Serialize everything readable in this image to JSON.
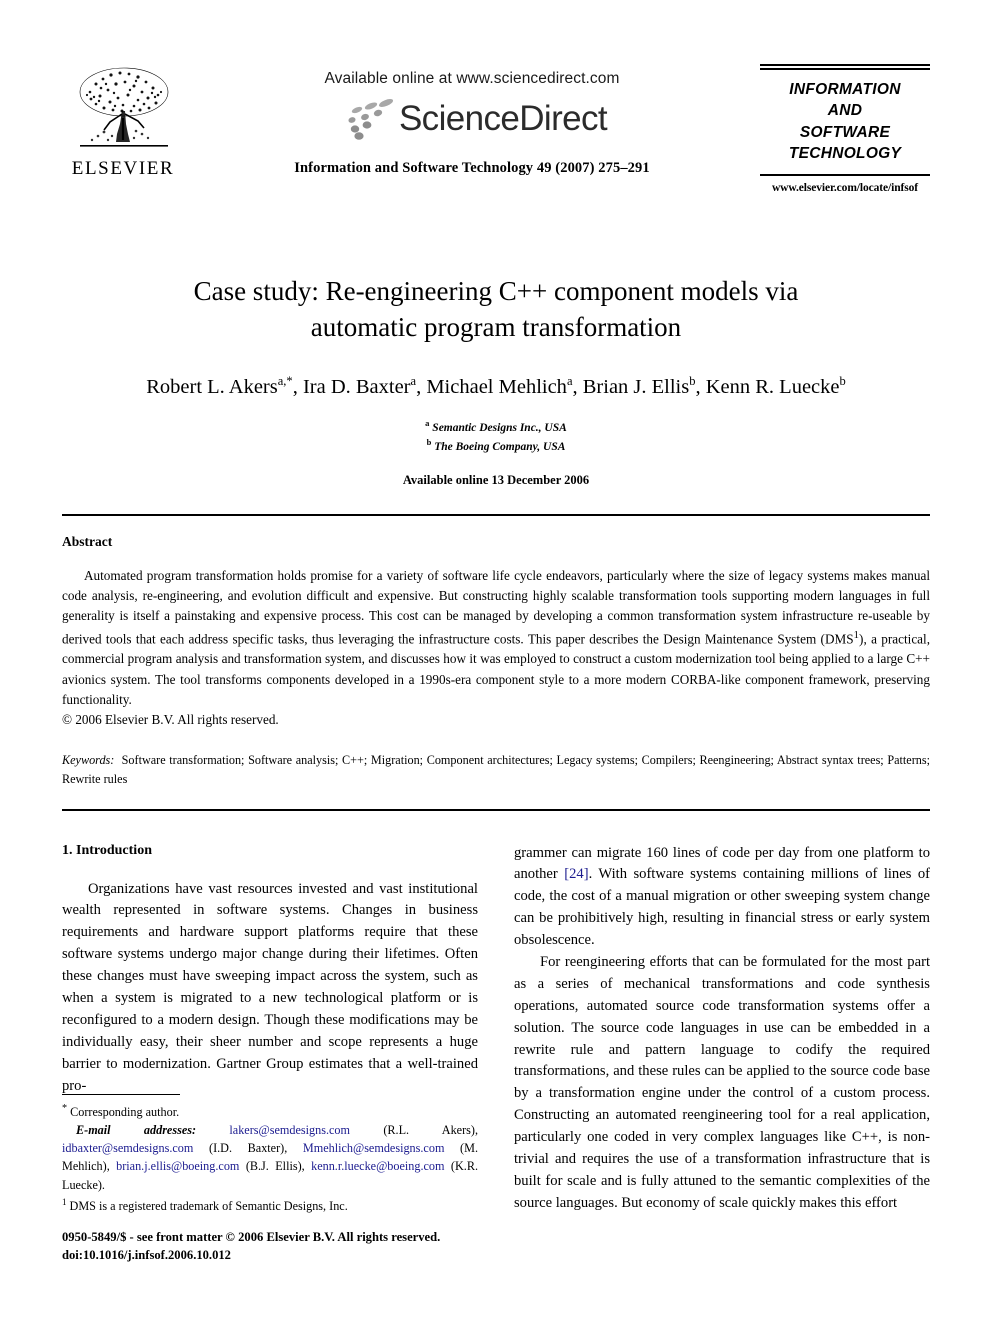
{
  "masthead": {
    "publisher_name": "ELSEVIER",
    "publisher_logo_icon": "elsevier-tree-icon",
    "available_online": "Available online at www.sciencedirect.com",
    "sciencedirect_wordmark": "ScienceDirect",
    "sciencedirect_logo_icon": "sciencedirect-swoosh-icon",
    "journal_reference": "Information and Software Technology 49 (2007) 275–291",
    "journal_title_lines": [
      "INFORMATION",
      "AND",
      "SOFTWARE",
      "TECHNOLOGY"
    ],
    "journal_url": "www.elsevier.com/locate/infsof"
  },
  "title_block": {
    "title_line_1": "Case study: Re-engineering C++ component models via",
    "title_line_2": "automatic program transformation",
    "authors": [
      {
        "name": "Robert L. Akers",
        "marks": "a,*",
        "sep": ", "
      },
      {
        "name": "Ira D. Baxter",
        "marks": "a",
        "sep": ", "
      },
      {
        "name": "Michael Mehlich",
        "marks": "a",
        "sep": ", "
      },
      {
        "name": "Brian J. Ellis",
        "marks": "b",
        "sep": ", "
      },
      {
        "name": "Kenn R. Luecke",
        "marks": "b",
        "sep": ""
      }
    ],
    "affiliations": [
      {
        "mark": "a",
        "text": "Semantic Designs Inc., USA"
      },
      {
        "mark": "b",
        "text": "The Boeing Company, USA"
      }
    ],
    "available_date": "Available online 13 December 2006"
  },
  "abstract": {
    "heading": "Abstract",
    "body_part_1": "Automated program transformation holds promise for a variety of software life cycle endeavors, particularly where the size of legacy systems makes manual code analysis, re-engineering, and evolution difficult and expensive. But constructing highly scalable transformation tools supporting modern languages in full generality is itself a painstaking and expensive process. This cost can be managed by developing a common transformation system infrastructure re-useable by derived tools that each address specific tasks, thus leveraging the infrastructure costs. This paper describes the Design Maintenance System (DMS",
    "footnote_marker": "1",
    "body_part_2": "), a practical, commercial program analysis and transformation system, and discusses how it was employed to construct a custom modernization tool being applied to a large C++ avionics system. The tool transforms components developed in a 1990s-era component style to a more modern CORBA-like component framework, preserving functionality.",
    "copyright": "© 2006 Elsevier B.V. All rights reserved."
  },
  "keywords": {
    "label": "Keywords:",
    "text": "Software transformation; Software analysis; C++; Migration; Component architectures; Legacy systems; Compilers; Reengineering; Abstract syntax trees; Patterns; Rewrite rules"
  },
  "body": {
    "left_column": {
      "section_heading": "1. Introduction",
      "paragraph_1": "Organizations have vast resources invested and vast institutional wealth represented in software systems. Changes in business requirements and hardware support platforms require that these software systems undergo major change during their lifetimes. Often these changes must have sweeping impact across the system, such as when a system is migrated to a new technological platform or is reconfigured to a modern design. Though these modifications may be individually easy, their sheer number and scope represents a huge barrier to modernization. Gartner Group estimates that a well-trained pro-"
    },
    "right_column": {
      "paragraph_1_before_cite": "grammer can migrate 160 lines of code per day from one platform to another ",
      "citation": "[24]",
      "paragraph_1_after_cite": ". With software systems containing millions of lines of code, the cost of a manual migration or other sweeping system change can be prohibitively high, resulting in financial stress or early system obsolescence.",
      "paragraph_2": "For reengineering efforts that can be formulated for the most part as a series of mechanical transformations and code synthesis operations, automated source code transformation systems offer a solution. The source code languages in use can be embedded in a rewrite rule and pattern language to codify the required transformations, and these rules can be applied to the source code base by a transformation engine under the control of a custom process. Constructing an automated reengineering tool for a real application, particularly one coded in very complex languages like C++, is non-trivial and requires the use of a transformation infrastructure that is built for scale and is fully attuned to the semantic complexities of the source languages. But economy of scale quickly makes this effort"
    }
  },
  "footnotes": {
    "corresponding_marker": "*",
    "corresponding_text": "Corresponding author.",
    "email_label": "E-mail addresses:",
    "emails": [
      {
        "address": "lakers@semdesigns.com",
        "owner": "(R.L. Akers)"
      },
      {
        "address": "idbaxter@semdesigns.com",
        "owner": "(I.D. Baxter)"
      },
      {
        "address": "Mmehlich@semdesigns.com",
        "owner": "(M. Mehlich)"
      },
      {
        "address": "brian.j.ellis@boeing.com",
        "owner": "(B.J. Ellis)"
      },
      {
        "address": "kenn.r.luecke@boeing.com",
        "owner": "(K.R. Luecke)"
      }
    ],
    "note_1_marker": "1",
    "note_1_text": "DMS is a registered trademark of Semantic Designs, Inc."
  },
  "footer": {
    "line_1": "0950-5849/$ - see front matter © 2006 Elsevier B.V. All rights reserved.",
    "line_2": "doi:10.1016/j.infsof.2006.10.012"
  },
  "colors": {
    "link": "#1b1b8f",
    "text": "#000000",
    "background": "#ffffff",
    "sciencedirect_gray": "#8d8d8d"
  }
}
